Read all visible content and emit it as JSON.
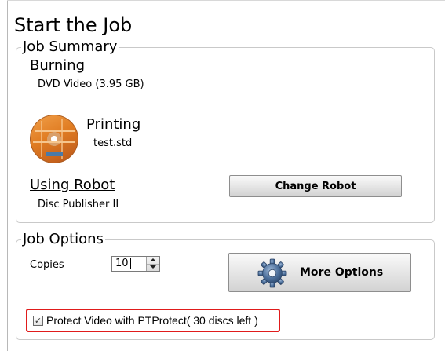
{
  "page": {
    "title": "Start the Job"
  },
  "job_summary": {
    "legend": "Job Summary",
    "burning_label": "Burning",
    "burning_value": "DVD Video (3.95 GB)",
    "printing_label": "Printing",
    "printing_value": "test.std",
    "robot_label": "Using Robot",
    "robot_value": "Disc Publisher II",
    "change_robot_button": "Change Robot"
  },
  "job_options": {
    "legend": "Job Options",
    "copies_label": "Copies",
    "copies_value": "10",
    "more_options_button": "More Options",
    "protect_checkbox": {
      "label": "Protect Video with PTProtect( 30 discs left )",
      "checked": true
    }
  },
  "colors": {
    "highlight": "#e01b1b",
    "group_border": "#c9c9c9"
  },
  "icons": [
    "disc-label-thumbnail",
    "gear-icon",
    "spin-up-arrow-icon",
    "spin-down-arrow-icon",
    "checkmark-icon"
  ]
}
